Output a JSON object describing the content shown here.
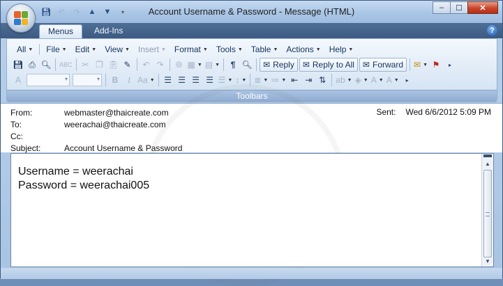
{
  "window": {
    "title": "Account Username & Password - Message (HTML)",
    "controls": {
      "minimize": "–",
      "maximize": "☐",
      "close": "✕"
    }
  },
  "quick_access": [
    "save-icon",
    "undo-icon",
    "redo-icon",
    "up-icon",
    "down-icon",
    "customize-icon"
  ],
  "tabs": [
    {
      "label": "Menus",
      "active": true
    },
    {
      "label": "Add-Ins",
      "active": false
    }
  ],
  "menus": [
    {
      "label": "All",
      "enabled": true
    },
    {
      "label": "File",
      "enabled": true
    },
    {
      "label": "Edit",
      "enabled": true
    },
    {
      "label": "View",
      "enabled": true
    },
    {
      "label": "Insert",
      "enabled": false
    },
    {
      "label": "Format",
      "enabled": true
    },
    {
      "label": "Tools",
      "enabled": true
    },
    {
      "label": "Table",
      "enabled": true
    },
    {
      "label": "Actions",
      "enabled": true
    },
    {
      "label": "Help",
      "enabled": true
    }
  ],
  "toolbar": {
    "reply_label": "Reply",
    "reply_all_label": "Reply to All",
    "forward_label": "Forward",
    "group_label": "Toolbars"
  },
  "header": {
    "from_label": "From:",
    "from_value": "webmaster@thaicreate.com",
    "to_label": "To:",
    "to_value": "weerachai@thaicreate.com",
    "cc_label": "Cc:",
    "cc_value": "",
    "subject_label": "Subject:",
    "subject_value": "Account Username & Password",
    "sent_label": "Sent:",
    "sent_value": "Wed 6/6/2012 5:09 PM"
  },
  "body": {
    "lines": [
      "Username = weerachai",
      "Password = weerachai005"
    ]
  },
  "colors": {
    "ribbon_blue": "#dde9f6",
    "tab_bar": "#3c5a82",
    "close_red": "#c9462b"
  }
}
